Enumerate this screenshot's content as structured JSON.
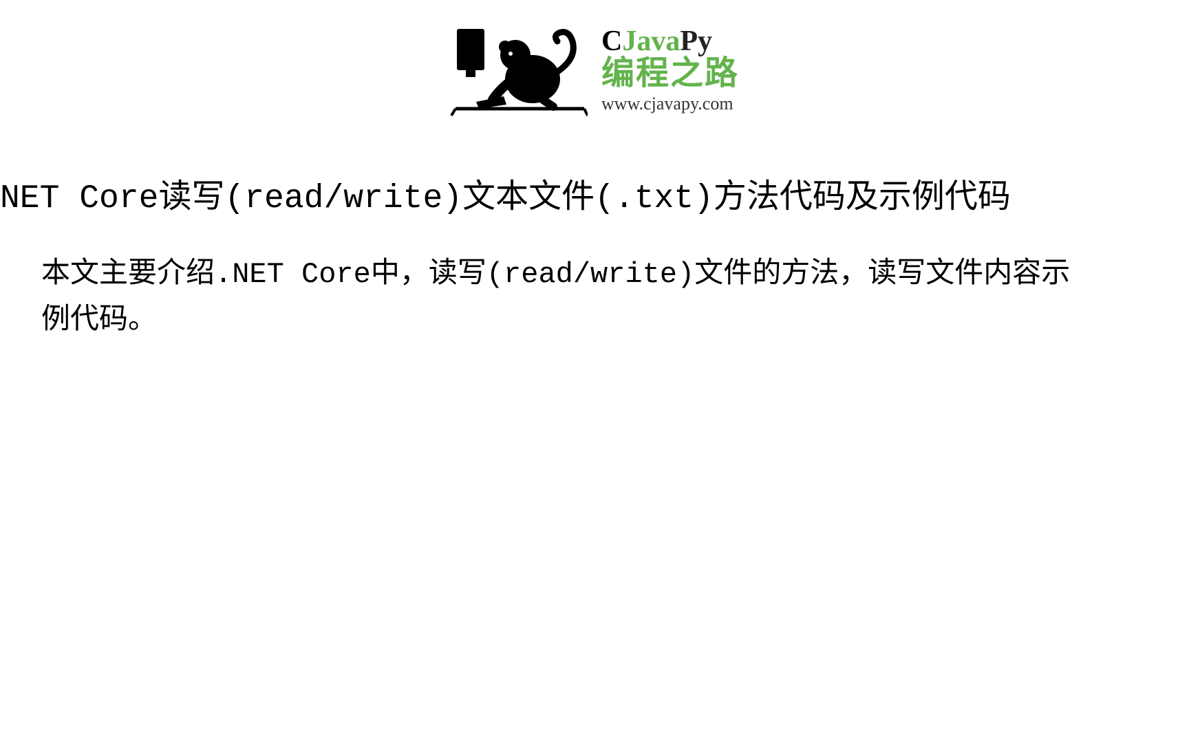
{
  "logo": {
    "brand_c": "C",
    "brand_java": "Java",
    "brand_py": "Py",
    "cn_text": "编程之路",
    "url": "www.cjavapy.com"
  },
  "title": "NET Core读写(read/write)文本文件(.txt)方法代码及示例代码",
  "body": "本文主要介绍.NET Core中，读写(read/write)文件的方法，读写文件内容示例代码。"
}
